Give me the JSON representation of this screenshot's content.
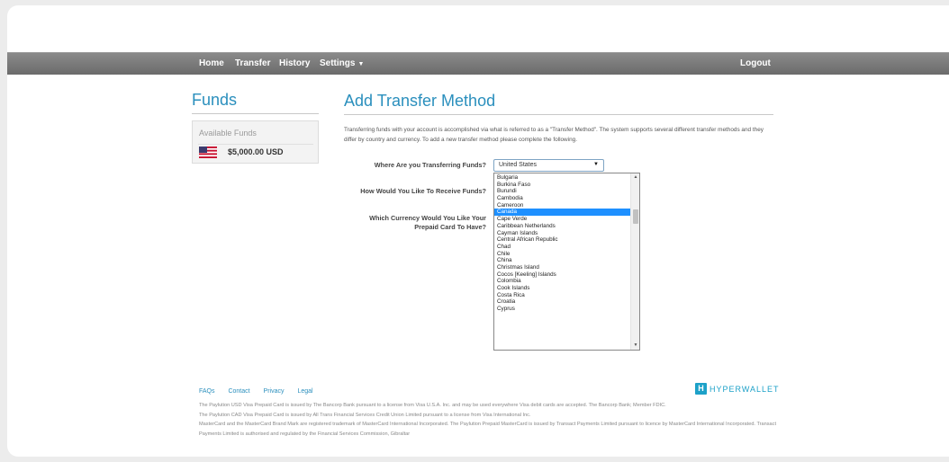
{
  "nav": {
    "home": "Home",
    "transfer": "Transfer",
    "history": "History",
    "settings": "Settings",
    "logout": "Logout"
  },
  "sidebar": {
    "title": "Funds",
    "available_label": "Available Funds",
    "balance": "$5,000.00 USD",
    "flag_icon": "us-flag-icon"
  },
  "main": {
    "title": "Add Transfer Method",
    "intro": "Transferring funds with your account is accomplished via what is referred to as a \"Transfer Method\". The system supports several different transfer methods and they differ by country and currency. To add a new transfer method please complete the following.",
    "q_country": "Where Are you Transferring Funds?",
    "q_receive": "How Would You Like To Receive Funds?",
    "q_currency": "Which Currency Would You Like Your Prepaid Card To Have?",
    "country_value": "United States"
  },
  "dropdown": {
    "selected_index": 6,
    "options": [
      "Bulgaria",
      "Burkina Faso",
      "Burundi",
      "Cambodia",
      "Cameroon",
      "Canada",
      "Cape Verde",
      "Caribbean Netherlands",
      "Cayman Islands",
      "Central African Republic",
      "Chad",
      "Chile",
      "China",
      "Christmas Island",
      "Cocos [Keeling] Islands",
      "Colombia",
      "Cook Islands",
      "Costa Rica",
      "Croatia",
      "Cyprus"
    ]
  },
  "footer": {
    "links": [
      "FAQs",
      "Contact",
      "Privacy",
      "Legal"
    ],
    "brand_mark": "H",
    "brand_name": "HYPERWALLET",
    "legal": [
      "The Paylution USD Visa Prepaid Card is issued by The Bancorp Bank pursuant to a license from Visa U.S.A. Inc. and may be used everywhere Visa debit cards are accepted. The Bancorp Bank; Member FDIC.",
      "The Paylution CAD Visa Prepaid Card is issued by All Trans Financial Services Credit Union Limited pursuant to a license from Visa International Inc.",
      "MasterCard and the MasterCard Brand Mark are registered trademark of MasterCard International Incorporated. The Paylution Prepaid MasterCard is issued by Transact Payments Limited pursuant to licence by MasterCard International Incorporated. Transact Payments Limited is authorised and regulated by the Financial Services Commission, Gibraltar"
    ]
  },
  "colors": {
    "accent": "#2a8fbd",
    "navbar": "#7a7a7a",
    "selected_option": "#1e90ff",
    "brand": "#1da1c8"
  }
}
